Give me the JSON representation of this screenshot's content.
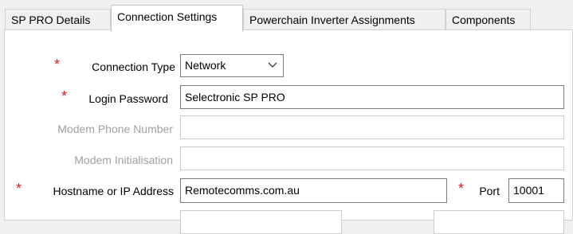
{
  "tabs": [
    {
      "label": "SP PRO Details"
    },
    {
      "label": "Connection Settings"
    },
    {
      "label": "Powerchain Inverter Assignments"
    },
    {
      "label": "Components"
    }
  ],
  "required_marker": "*",
  "form": {
    "connection_type": {
      "label": "Connection Type",
      "value": "Network"
    },
    "login_password": {
      "label": "Login Password",
      "value": "Selectronic SP PRO"
    },
    "modem_phone": {
      "label": "Modem Phone Number",
      "value": ""
    },
    "modem_init": {
      "label": "Modem Initialisation",
      "value": ""
    },
    "hostname": {
      "label": "Hostname or IP Address",
      "value": "Remotecomms.com.au"
    },
    "port": {
      "label": "Port",
      "value": "10001"
    }
  },
  "icons": {
    "dropdown": "chevron-down-icon"
  },
  "colors": {
    "required": "#e02020",
    "disabled_text": "#a0a0a0",
    "active_tab": "#ffffff"
  }
}
